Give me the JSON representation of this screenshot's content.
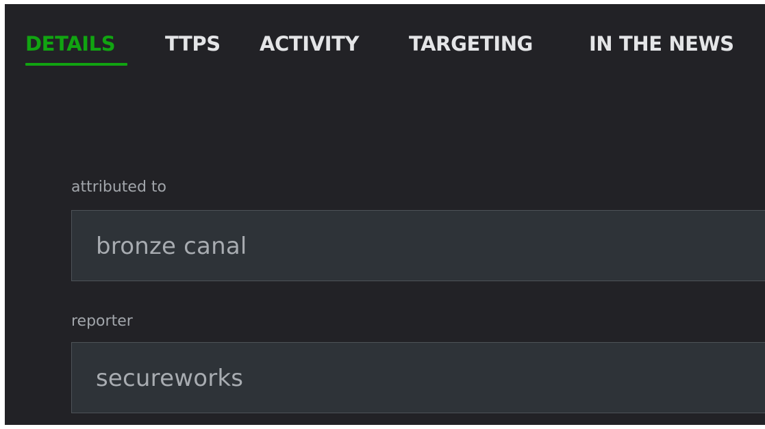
{
  "tabs": [
    {
      "label": "DETAILS",
      "active": true
    },
    {
      "label": "TTPS",
      "active": false
    },
    {
      "label": "ACTIVITY",
      "active": false
    },
    {
      "label": "TARGETING",
      "active": false
    },
    {
      "label": "IN THE NEWS",
      "active": false
    }
  ],
  "fields": {
    "attributed_to": {
      "label": "attributed to",
      "value": "bronze canal"
    },
    "reporter": {
      "label": "reporter",
      "value": "secureworks"
    }
  },
  "colors": {
    "background": "#222226",
    "accent": "#11a411",
    "tab_text": "#e4e5e7",
    "label_text": "#a2a6ab",
    "field_background": "#2e3338",
    "field_text": "#a8acb1"
  }
}
